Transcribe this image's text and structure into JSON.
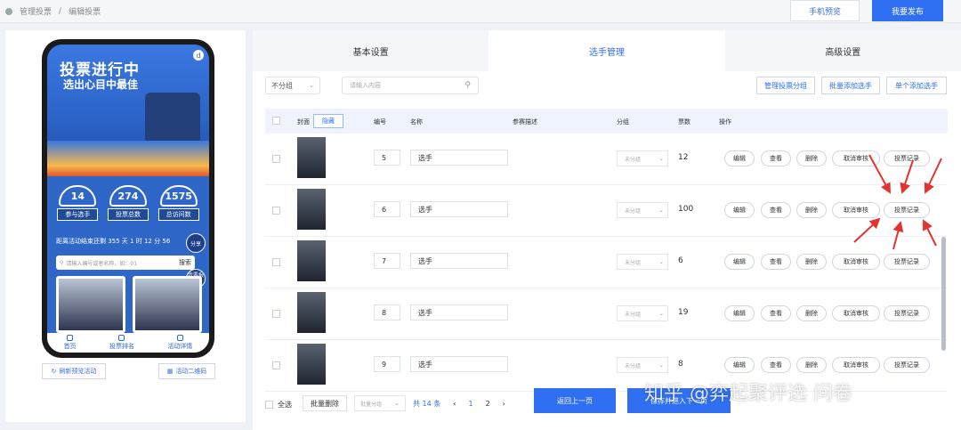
{
  "topbar": {
    "breadcrumb": [
      "管理投票",
      "编辑投票"
    ],
    "preview_label": "手机预览",
    "publish_label": "我要发布"
  },
  "preview": {
    "banner_title": "投票进行中",
    "banner_subtitle": "选出心目中最佳",
    "stats": [
      {
        "value": "14",
        "label": "参与选手"
      },
      {
        "value": "274",
        "label": "投票总数"
      },
      {
        "value": "1575",
        "label": "总访问数"
      }
    ],
    "countdown": "距离活动结束还剩 355 天 1 时 12 分 56",
    "share_label": "分享",
    "search_placeholder": "请输入编号或者名称，如：01",
    "search_button": "搜索",
    "signup_label": "我要报名",
    "tabbar": [
      "首页",
      "投票排名",
      "活动详情"
    ],
    "refresh_label": "刷新预览活动",
    "qrcode_label": "活动二维码"
  },
  "tabs": [
    "基本设置",
    "选手管理",
    "高级设置"
  ],
  "active_tab": 1,
  "toolbar": {
    "group_filter": "不分组",
    "search_placeholder": "请输入内容",
    "btn_manage_groups": "管理投票分组",
    "btn_bulk_add": "批量添加选手",
    "btn_single_add": "单个添加选手"
  },
  "table": {
    "headers": {
      "cover": "封面",
      "hide": "隐藏",
      "number": "编号",
      "name": "名称",
      "description": "参赛描述",
      "group": "分组",
      "votes": "票数",
      "actions": "操作"
    },
    "rows": [
      {
        "number": "5",
        "name": "选手",
        "group": "未分组",
        "votes": "12"
      },
      {
        "number": "6",
        "name": "选手",
        "group": "未分组",
        "votes": "100"
      },
      {
        "number": "7",
        "name": "选手",
        "group": "未分组",
        "votes": "6"
      },
      {
        "number": "8",
        "name": "选手",
        "group": "未分组",
        "votes": "19"
      },
      {
        "number": "9",
        "name": "选手",
        "group": "未分组",
        "votes": "8"
      }
    ],
    "row_actions": [
      "编辑",
      "查看",
      "删除",
      "取消审核",
      "投票记录"
    ]
  },
  "footer": {
    "select_all": "全选",
    "bulk_delete": "批量删除",
    "bulk_group": "批量分组",
    "total": "共 14 条",
    "pages": [
      "1",
      "2"
    ],
    "current_page": "1",
    "btn_prev": "返回上一页",
    "btn_next": "保存并进入下一页"
  },
  "watermark": "知乎 @弈起聚评选 问卷",
  "colors": {
    "primary": "#2f6ff2",
    "annotation_arrow": "#e5322d",
    "phone_theme": "#2f67c8"
  }
}
